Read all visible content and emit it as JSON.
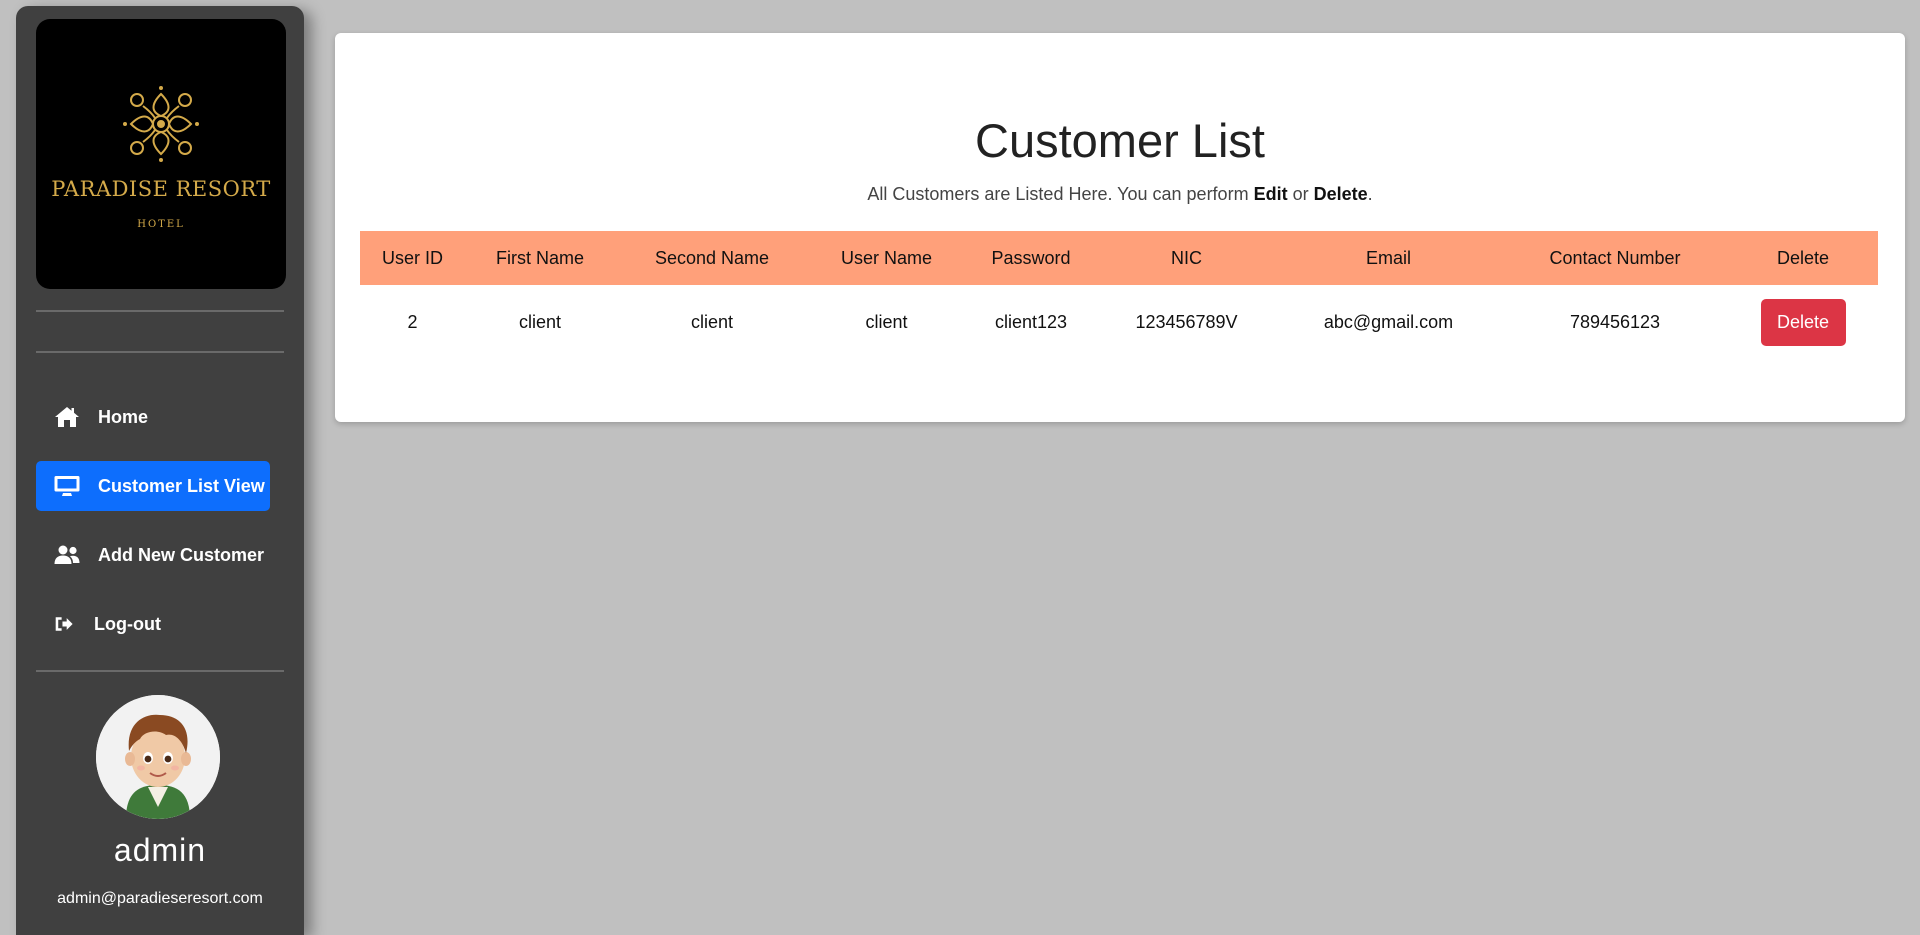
{
  "brand": {
    "name": "PARADISE RESORT",
    "tagline": "HOTEL"
  },
  "nav": {
    "items": [
      {
        "label": "Home",
        "icon": "home-icon",
        "active": false
      },
      {
        "label": "Customer List View",
        "icon": "monitor-icon",
        "active": true
      },
      {
        "label": "Add New Customer",
        "icon": "users-icon",
        "active": false
      },
      {
        "label": "Log-out",
        "icon": "sign-out-icon",
        "active": false
      }
    ]
  },
  "user": {
    "name": "admin",
    "email": "admin@paradieseresort.com"
  },
  "main": {
    "title": "Customer List",
    "subtitle_prefix": "All Customers are Listed Here. You can perform ",
    "subtitle_edit": "Edit",
    "subtitle_or": " or ",
    "subtitle_delete": "Delete",
    "subtitle_suffix": "."
  },
  "table": {
    "headers": [
      "User ID",
      "First Name",
      "Second Name",
      "User Name",
      "Password",
      "NIC",
      "Email",
      "Contact Number",
      "Delete"
    ],
    "rows": [
      {
        "user_id": "2",
        "first_name": "client",
        "second_name": "client",
        "user_name": "client",
        "password": "client123",
        "nic": "123456789V",
        "email": "abc@gmail.com",
        "contact": "789456123",
        "delete_label": "Delete"
      }
    ]
  },
  "colors": {
    "sidebar_bg": "#404040",
    "active_nav": "#0d6efd",
    "table_header": "#ffa07a",
    "delete_button": "#dc3545",
    "logo_gold": "#d4aa4a"
  }
}
